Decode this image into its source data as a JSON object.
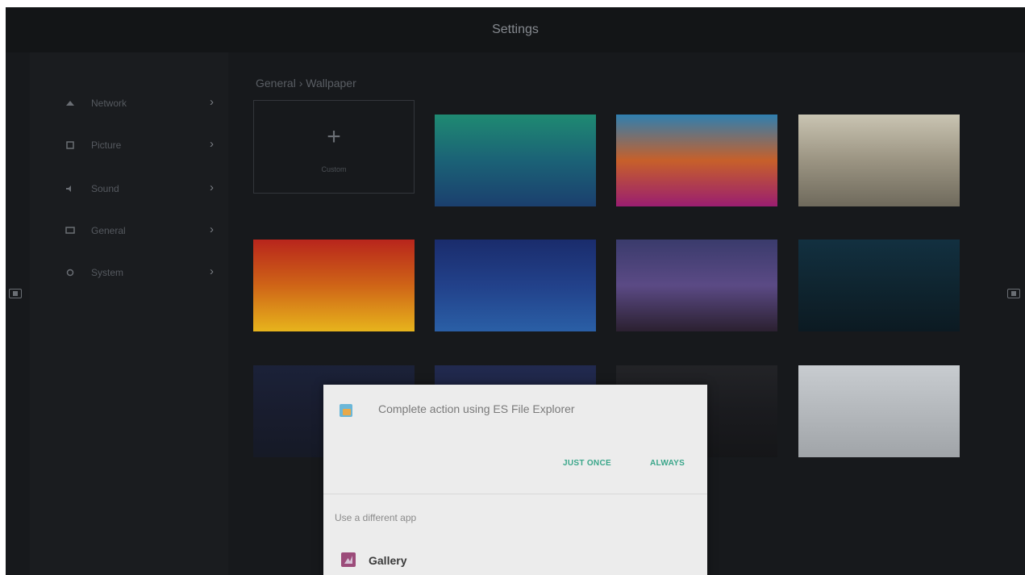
{
  "header": {
    "title": "Settings"
  },
  "sidebar": {
    "items": [
      {
        "label": "Network",
        "icon": "wifi-icon"
      },
      {
        "label": "Picture",
        "icon": "picture-icon"
      },
      {
        "label": "Sound",
        "icon": "sound-icon"
      },
      {
        "label": "General",
        "icon": "display-icon"
      },
      {
        "label": "System",
        "icon": "system-icon"
      }
    ],
    "chevron": "›"
  },
  "breadcrumb": "General  ›  Wallpaper",
  "wallpapers": {
    "custom": {
      "plus": "+",
      "label": "Custom"
    },
    "items": [
      {
        "name": "teal-gradient",
        "colors": [
          "#1f8a72",
          "#1b6276",
          "#1b3f6e"
        ]
      },
      {
        "name": "colorful-waves",
        "colors": [
          "#2f7fb0",
          "#c7602a",
          "#9a1e70"
        ]
      },
      {
        "name": "desk-photo",
        "colors": [
          "#c9c4b2",
          "#9b9482",
          "#6f6a5c"
        ]
      },
      {
        "name": "sunset-tree",
        "colors": [
          "#b8251c",
          "#cf6417",
          "#e7b41c"
        ]
      },
      {
        "name": "ocean-particles",
        "colors": [
          "#1a2c6c",
          "#22418a",
          "#2a5fa6"
        ]
      },
      {
        "name": "mountain-night",
        "colors": [
          "#3a3b6c",
          "#5b4a85",
          "#2b2030"
        ]
      },
      {
        "name": "dark-globe",
        "colors": [
          "#123040",
          "#0f2530",
          "#0c1a22"
        ]
      },
      {
        "name": "starry-blue",
        "colors": [
          "#1f2a55",
          "#1a2040",
          "#141a30"
        ]
      },
      {
        "name": "night-blue",
        "colors": [
          "#2b3a82",
          "#232c60",
          "#1a2040"
        ]
      },
      {
        "name": "moon-dark",
        "colors": [
          "#2a2a2e",
          "#1c1c20",
          "#141416"
        ]
      },
      {
        "name": "grey-room",
        "colors": [
          "#c8ccd0",
          "#b4b8bc",
          "#a0a4a8"
        ]
      }
    ]
  },
  "dialog": {
    "icon": "es-file-explorer-icon",
    "title": "Complete action using ES File Explorer",
    "just_once": "JUST ONCE",
    "always": "ALWAYS",
    "different_app": "Use a different app",
    "gallery": {
      "label": "Gallery",
      "icon": "gallery-icon"
    }
  }
}
